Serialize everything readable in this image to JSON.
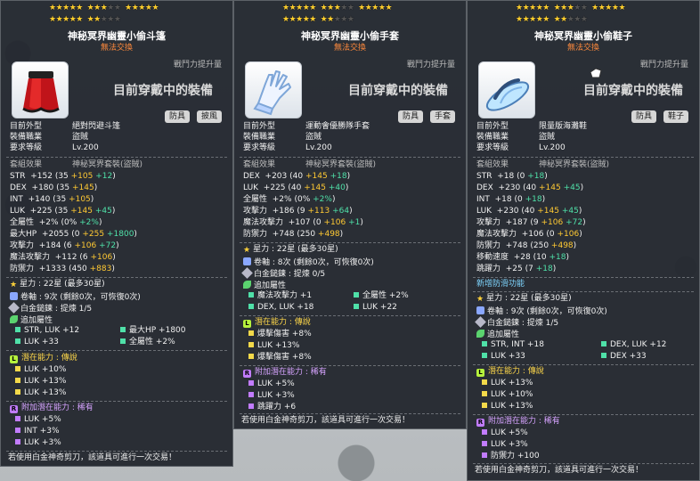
{
  "items": [
    {
      "stars_top": [
        "★★★★★",
        "★★★",
        "★★★★★"
      ],
      "stars_bottom": [
        "★★★★★",
        "★★"
      ],
      "name": "神秘冥界幽靈小偷斗篷",
      "no_trade": "無法交換",
      "attack_gain_label": "戰鬥力提升量",
      "wearing_label": "目前穿戴中的裝備",
      "tags": [
        "防具",
        "披風"
      ],
      "basic": [
        {
          "label": "目前外型",
          "value": "絕對閃避斗篷"
        },
        {
          "label": "裝備職業",
          "value": "盜賊"
        },
        {
          "label": "要求等級",
          "value": "Lv.200"
        }
      ],
      "set_label": "套組效果",
      "set_name": "神秘冥界套裝(盜賊)",
      "stats": [
        {
          "name": "STR",
          "total": "+152",
          "base": "(35 ",
          "add1": "+105",
          "add2": " +12",
          "tail": ")"
        },
        {
          "name": "DEX",
          "total": "+180",
          "base": "(35 ",
          "add1": "+145",
          "add2": "",
          "tail": ")"
        },
        {
          "name": "INT",
          "total": "+140",
          "base": "(35 ",
          "add1": "+105",
          "add2": "",
          "tail": ")"
        },
        {
          "name": "LUK",
          "total": "+225",
          "base": "(35 ",
          "add1": "+145",
          "add2": " +45",
          "tail": ")"
        },
        {
          "name": "全屬性",
          "total": "+2%",
          "base": "(0% ",
          "add1": "",
          "add2": "+2%",
          "tail": ")"
        },
        {
          "name": "最大HP",
          "total": "+2055",
          "base": "(0 ",
          "add1": "+255",
          "add2": " +1800",
          "tail": ")"
        },
        {
          "name": "攻擊力",
          "total": "+184",
          "base": "(6 ",
          "add1": "+106",
          "add2": " +72",
          "tail": ")"
        },
        {
          "name": "魔法攻擊力",
          "total": "+112",
          "base": "(6 ",
          "add1": "+106",
          "add2": "",
          "tail": ")"
        },
        {
          "name": "防禦力",
          "total": "+1333",
          "base": "(450 ",
          "add1": "+883",
          "add2": "",
          "tail": ")"
        }
      ],
      "star_force": "星力 : 22星 (最多30星)",
      "scroll": "卷軸 : 9次 (剩餘0次，可恢復0次)",
      "hammer": "白金鎚鍊 : 提煉 1/5",
      "extra_label": "追加屬性",
      "extra": [
        [
          "STR, LUK +12",
          "最大HP +1800"
        ],
        [
          "LUK +33",
          "全屬性 +2%"
        ]
      ],
      "potential_label": "潛在能力 : 傳說",
      "potential": [
        "LUK +10%",
        "LUK +13%",
        "LUK +13%"
      ],
      "bonus_label": "附加潛在能力 : 稀有",
      "bonus": [
        "LUK +5%",
        "INT +3%",
        "LUK +3%"
      ],
      "footer": "若使用白金神奇剪刀，該道具可進行一次交易！"
    },
    {
      "stars_top": [
        "★★★★★",
        "★★★",
        "★★★★★"
      ],
      "stars_bottom": [
        "★★★★★",
        "★★"
      ],
      "name": "神秘冥界幽靈小偷手套",
      "no_trade": "無法交換",
      "attack_gain_label": "戰鬥力提升量",
      "wearing_label": "目前穿戴中的裝備",
      "tags": [
        "防具",
        "手套"
      ],
      "basic": [
        {
          "label": "目前外型",
          "value": "運動會優勝隊手套"
        },
        {
          "label": "裝備職業",
          "value": "盜賊"
        },
        {
          "label": "要求等級",
          "value": "Lv.200"
        }
      ],
      "set_label": "套組效果",
      "set_name": "神秘冥界套裝(盜賊)",
      "stats": [
        {
          "name": "DEX",
          "total": "+203",
          "base": "(40 ",
          "add1": "+145",
          "add2": " +18",
          "tail": ")"
        },
        {
          "name": "LUK",
          "total": "+225",
          "base": "(40 ",
          "add1": "+145",
          "add2": " +40",
          "tail": ")"
        },
        {
          "name": "全屬性",
          "total": "+2%",
          "base": "(0% ",
          "add1": "",
          "add2": "+2%",
          "tail": ")"
        },
        {
          "name": "攻擊力",
          "total": "+186",
          "base": "(9 ",
          "add1": "+113",
          "add2": " +64",
          "tail": ")"
        },
        {
          "name": "魔法攻擊力",
          "total": "+107",
          "base": "(0 ",
          "add1": "+106",
          "add2": " +1",
          "tail": ")"
        },
        {
          "name": "防禦力",
          "total": "+748",
          "base": "(250 ",
          "add1": "+498",
          "add2": "",
          "tail": ")"
        }
      ],
      "star_force": "星力 : 22星 (最多30星)",
      "scroll": "卷軸 : 8次 (剩餘0次，可恢復0次)",
      "hammer": "白金鎚鍊 : 提煉 0/5",
      "extra_label": "追加屬性",
      "extra": [
        [
          "魔法攻擊力 +1",
          "全屬性 +2%"
        ],
        [
          "DEX, LUK +18",
          "LUK +22"
        ]
      ],
      "potential_label": "潛在能力 : 傳說",
      "potential": [
        "爆擊傷害 +8%",
        "LUK +13%",
        "爆擊傷害 +8%"
      ],
      "bonus_label": "附加潛在能力 : 稀有",
      "bonus": [
        "LUK +5%",
        "LUK +3%",
        "跳躍力 +6"
      ],
      "footer": "若使用白金神奇剪刀，該道具可進行一次交易！"
    },
    {
      "stars_top": [
        "★★★★★",
        "★★★",
        "★★★★★"
      ],
      "stars_bottom": [
        "★★★★★",
        "★★"
      ],
      "name": "神秘冥界幽靈小偷鞋子",
      "no_trade": "無法交換",
      "attack_gain_label": "戰鬥力提升量",
      "wearing_label": "目前穿戴中的裝備",
      "tags": [
        "防具",
        "鞋子"
      ],
      "basic": [
        {
          "label": "目前外型",
          "value": "限量版海灘鞋"
        },
        {
          "label": "裝備職業",
          "value": "盜賊"
        },
        {
          "label": "要求等級",
          "value": "Lv.200"
        }
      ],
      "set_label": "套組效果",
      "set_name": "神秘冥界套裝(盜賊)",
      "stats": [
        {
          "name": "STR",
          "total": "+18",
          "base": "(0 ",
          "add1": "",
          "add2": "+18",
          "tail": ")"
        },
        {
          "name": "DEX",
          "total": "+230",
          "base": "(40 ",
          "add1": "+145",
          "add2": " +45",
          "tail": ")"
        },
        {
          "name": "INT",
          "total": "+18",
          "base": "(0 ",
          "add1": "",
          "add2": "+18",
          "tail": ")"
        },
        {
          "name": "LUK",
          "total": "+230",
          "base": "(40 ",
          "add1": "+145",
          "add2": " +45",
          "tail": ")"
        },
        {
          "name": "攻擊力",
          "total": "+187",
          "base": "(9 ",
          "add1": "+106",
          "add2": " +72",
          "tail": ")"
        },
        {
          "name": "魔法攻擊力",
          "total": "+106",
          "base": "(0 ",
          "add1": "+106",
          "add2": "",
          "tail": ")"
        },
        {
          "name": "防禦力",
          "total": "+748",
          "base": "(250 ",
          "add1": "+498",
          "add2": "",
          "tail": ")"
        },
        {
          "name": "移動速度",
          "total": "+28",
          "base": "(10 ",
          "add1": "",
          "add2": "+18",
          "tail": ")"
        },
        {
          "name": "跳躍力",
          "total": "+25",
          "base": "(7 ",
          "add1": "",
          "add2": "+18",
          "tail": ")"
        }
      ],
      "new_feature": "新增防滑功能",
      "star_force": "星力 : 22星 (最多30星)",
      "scroll": "卷軸 : 9次 (剩餘0次，可恢復0次)",
      "hammer": "白金鎚鍊 : 提煉 1/5",
      "extra_label": "追加屬性",
      "extra": [
        [
          "STR, INT +18",
          "DEX, LUK +12"
        ],
        [
          "LUK +33",
          "DEX +33"
        ]
      ],
      "potential_label": "潛在能力 : 傳說",
      "potential": [
        "LUK +13%",
        "LUK +10%",
        "LUK +13%"
      ],
      "bonus_label": "附加潛在能力 : 稀有",
      "bonus": [
        "LUK +5%",
        "LUK +3%",
        "防禦力 +100"
      ],
      "footer": "若使用白金神奇剪刀，該道具可進行一次交易！"
    }
  ]
}
